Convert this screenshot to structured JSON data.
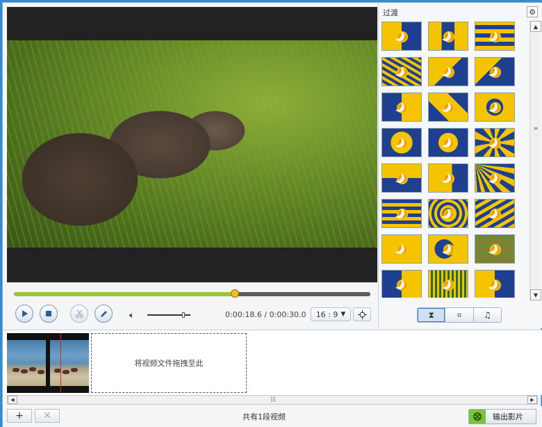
{
  "panel": {
    "title": "过渡"
  },
  "player": {
    "progress": 0.62,
    "volume": 0.84,
    "time_current": "0:00:18.6",
    "time_separator": "/",
    "time_total": "0:00:30.0",
    "aspect_ratio": "16 : 9"
  },
  "tabs": [
    {
      "name": "transitions",
      "icon": "transition-icon",
      "glyph": "⧗",
      "active": true
    },
    {
      "name": "crop",
      "icon": "crop-icon",
      "glyph": "⌗",
      "active": false
    },
    {
      "name": "music",
      "icon": "music-icon",
      "glyph": "♫",
      "active": false
    }
  ],
  "timeline": {
    "drop_hint": "将视频文件拖拽至此"
  },
  "bottom": {
    "count_text": "共有1段视频",
    "export_label": "输出影片"
  },
  "colors": {
    "transition_blue": "#1f3f8f",
    "transition_yellow": "#f5c400",
    "seek_fill": "#9cc63a",
    "knob": "#f0c020"
  }
}
